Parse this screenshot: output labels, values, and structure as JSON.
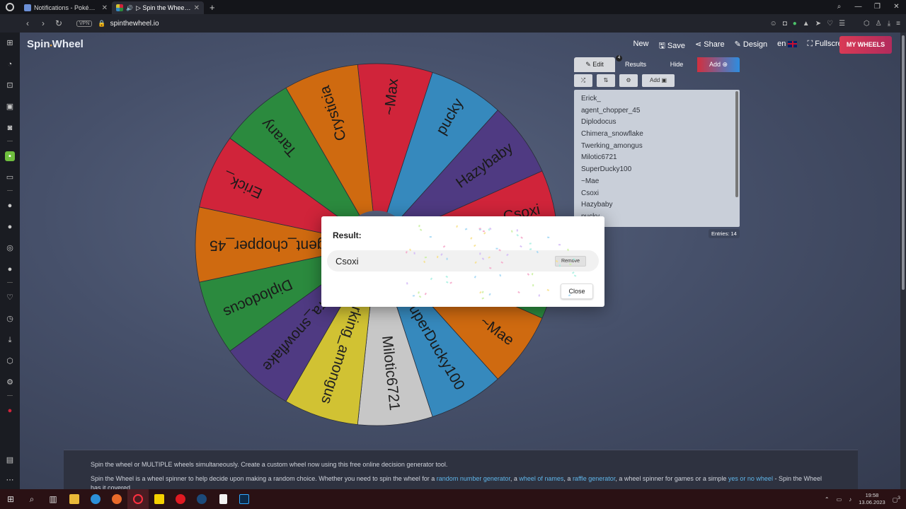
{
  "browser": {
    "tabs": [
      {
        "label": "Notifications - PokéHeroes",
        "active": false
      },
      {
        "label": "▷ Spin the Wheel » Cus",
        "active": true
      }
    ],
    "new_tab_symbol": "+",
    "url": "spinthewheel.io",
    "vpn_label": "VPN"
  },
  "header": {
    "logo_part1": "Spin",
    "logo_dot": "•",
    "logo_part2": "Wheel",
    "nav": {
      "new": "New",
      "save": "Save",
      "share": "Share",
      "design": "Design",
      "lang": "en",
      "fullscreen": "Fullscreen"
    },
    "my_wheels": "MY WHEELS"
  },
  "panel": {
    "tabs": {
      "edit": "Edit",
      "results": "Results",
      "results_badge": "4",
      "hide": "Hide",
      "add": "Add"
    },
    "tool_add": "Add",
    "entries": [
      "Erick_",
      "agent_chopper_45",
      "Diplodocus",
      "Chimera_snowflake",
      "Twerking_amongus",
      "Milotic6721",
      "SuperDucky100",
      "~Mae",
      "Csoxi",
      "Hazybaby",
      "pucky"
    ],
    "entries_count": "Entries: 14"
  },
  "wheel": {
    "segments": [
      {
        "label": "~Max",
        "color": "#d0243a"
      },
      {
        "label": "pucky",
        "color": "#3689bd"
      },
      {
        "label": "Hazybaby",
        "color": "#4f3a82"
      },
      {
        "label": "Csoxi",
        "color": "#d0243a"
      },
      {
        "label": "",
        "color": "#2b8a3e"
      },
      {
        "label": "~Mae",
        "color": "#cf6a10"
      },
      {
        "label": "SuperDucky100",
        "color": "#3689bd"
      },
      {
        "label": "Milotic6721",
        "color": "#c7c7c7"
      },
      {
        "label": "Twerking_amongus",
        "color": "#d1c233"
      },
      {
        "label": "Chimera_snowflake",
        "color": "#4f3a82"
      },
      {
        "label": "Diplodocus",
        "color": "#2b8a3e"
      },
      {
        "label": "agent_chopper_45",
        "color": "#cf6a10"
      },
      {
        "label": "Erick_",
        "color": "#d0243a"
      },
      {
        "label": "Tarany",
        "color": "#2b8a3e"
      },
      {
        "label": "Crysticia",
        "color": "#cf6a10"
      }
    ]
  },
  "modal": {
    "title": "Result:",
    "value": "Csoxi",
    "remove": "Remove",
    "close": "Close"
  },
  "info": {
    "p1": "Spin the wheel or MULTIPLE wheels simultaneously. Create a custom wheel now using this free online decision generator tool.",
    "p2_a": "Spin the Wheel is a wheel spinner to help decide upon making a random choice. Whether you need to spin the wheel for a ",
    "link1": "random number generator",
    "p2_b": ", a ",
    "link2": "wheel of names",
    "p2_c": ", a ",
    "link3": "raffle generator",
    "p2_d": ", a wheel spinner for games or a simple ",
    "link4": "yes or no wheel",
    "p2_e": " - Spin the Wheel has it covered."
  },
  "taskbar": {
    "time": "19:58",
    "date": "13.06.2023",
    "notif": "3"
  },
  "colors": {
    "accent_red": "#d93a55",
    "link_blue": "#5fb5e8"
  }
}
